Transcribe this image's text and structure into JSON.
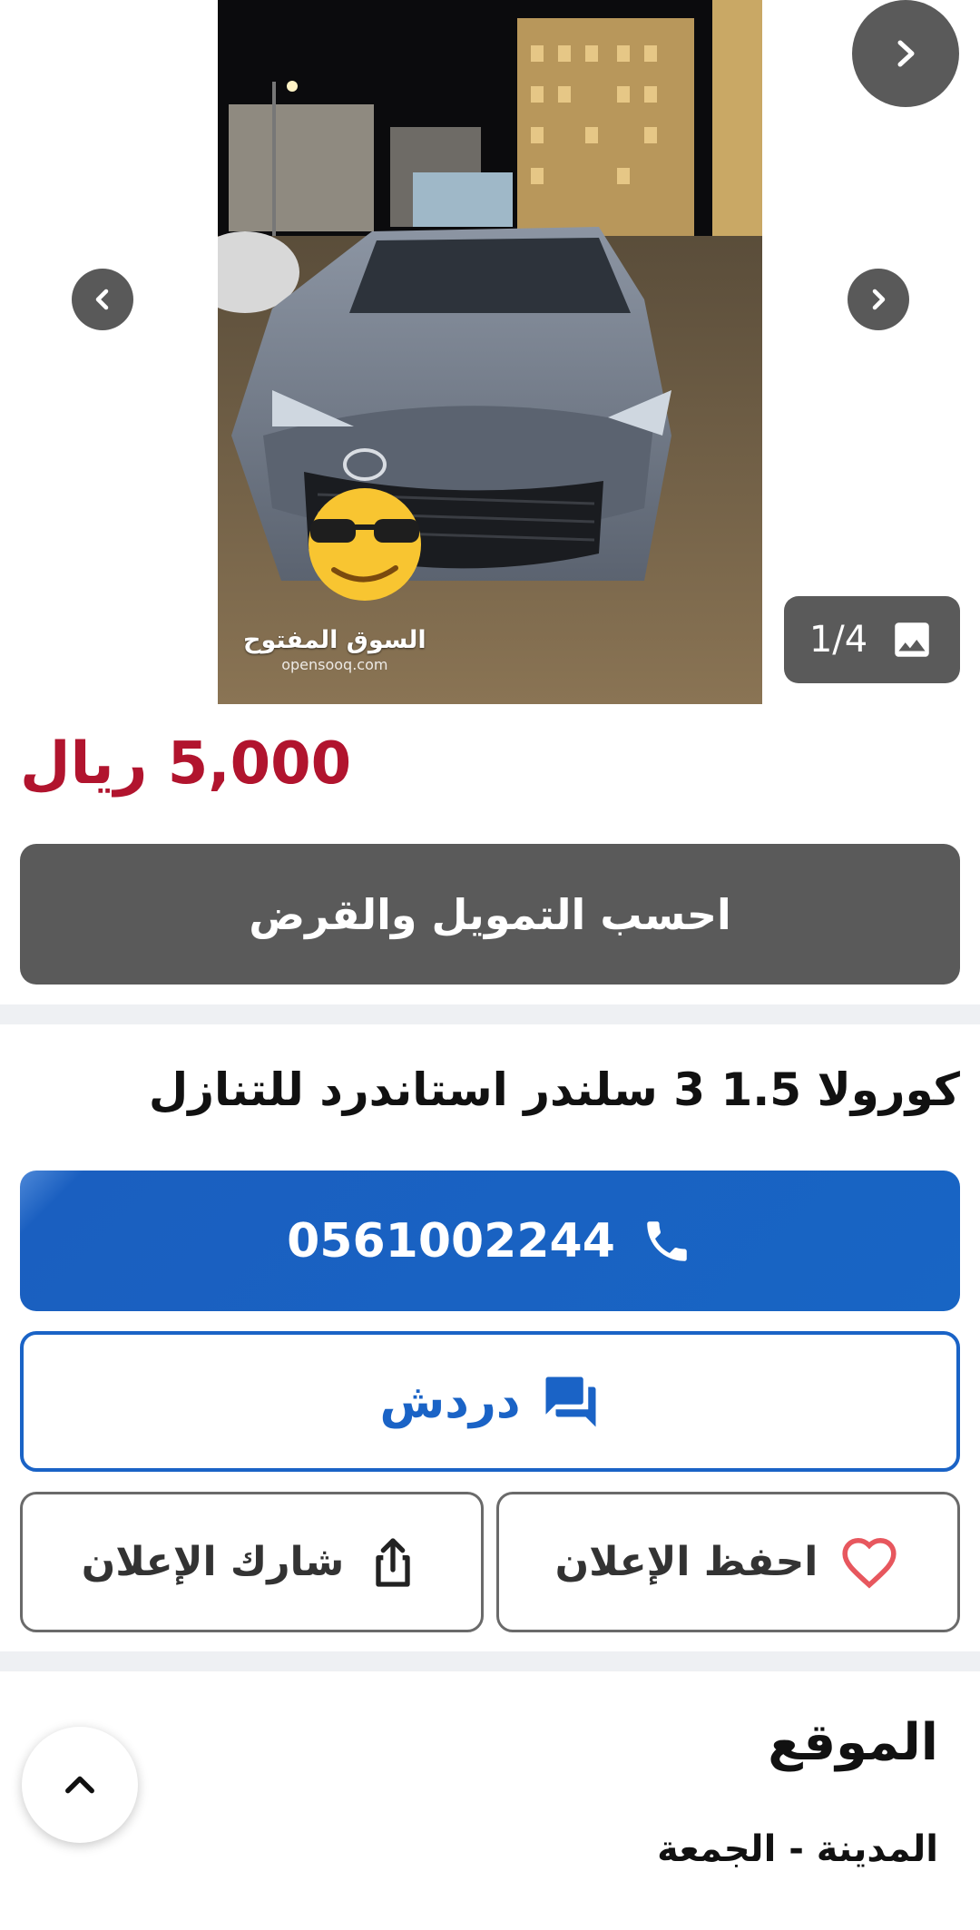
{
  "gallery": {
    "counter": "1/4",
    "watermark_ar": "السوق المفتوح",
    "watermark_en": "opensooq.com",
    "icons": {
      "next_top": "chevron-right-icon",
      "prev": "chevron-left-icon",
      "next": "chevron-right-icon",
      "image": "image-icon"
    }
  },
  "listing": {
    "price": "5,000 ريال",
    "price_color": "#b1142e",
    "finance_label": "احسب التمويل والقرض",
    "title": "كورولا 1.5 3 سلندر استاندرد للتنازل"
  },
  "actions": {
    "phone": "0561002244",
    "chat_label": "دردش",
    "save_label": "احفظ الإعلان",
    "share_label": "شارك الإعلان",
    "accent_color": "#1a63c6"
  },
  "location": {
    "heading": "الموقع",
    "value": "المدينة - الجمعة"
  }
}
